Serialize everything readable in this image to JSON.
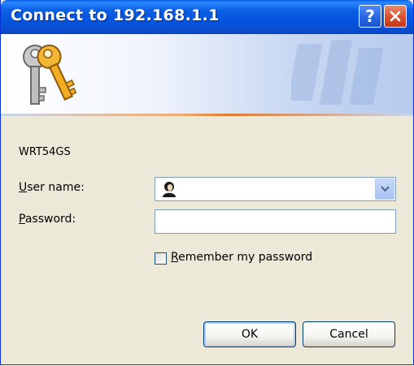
{
  "window": {
    "title": "Connect to 192.168.1.1",
    "help_label": "?",
    "title_bar_color": "#0a55e0",
    "banner_accent_color": "#e07a2c"
  },
  "dialog": {
    "device_name": "WRT54GS",
    "username": {
      "label_mnemonic": "U",
      "label_rest": "ser name:",
      "value": ""
    },
    "password": {
      "label_mnemonic": "P",
      "label_rest": "assword:",
      "value": ""
    },
    "remember": {
      "label_mnemonic": "R",
      "label_rest": "emember my password",
      "checked": false
    },
    "ok_label": "OK",
    "cancel_label": "Cancel"
  },
  "icons": {
    "banner": "keys-icon",
    "user_field": "user-icon",
    "dropdown": "chevron-down-icon",
    "close": "close-icon"
  }
}
